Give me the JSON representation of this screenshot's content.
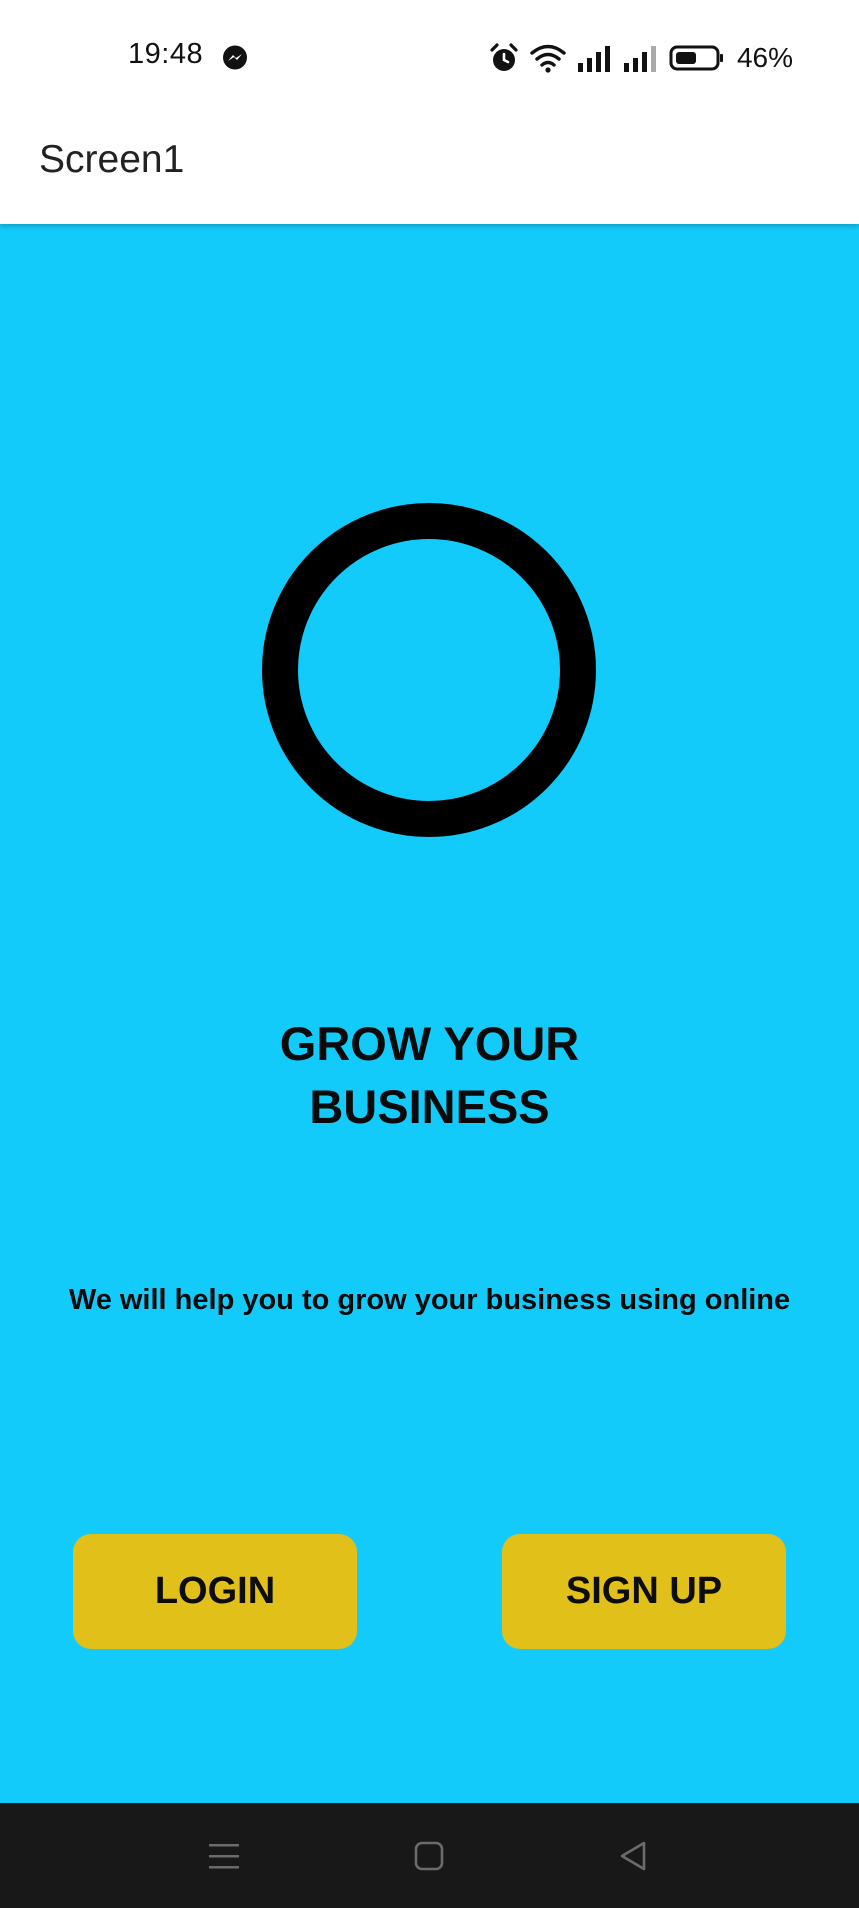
{
  "status_bar": {
    "time": "19:48",
    "battery_percent": "46%",
    "icons": [
      "messenger-icon",
      "alarm-icon",
      "wifi-icon",
      "signal-icon",
      "signal-icon",
      "battery-icon"
    ]
  },
  "app_bar": {
    "title": "Screen1"
  },
  "main": {
    "headline_line1": "GROW YOUR",
    "headline_line2": "BUSINESS",
    "tagline": "We will help you to grow your business using online"
  },
  "buttons": {
    "login_label": "LOGIN",
    "signup_label": "SIGN UP"
  },
  "nav_bar": {
    "icons": [
      "recents-menu-icon",
      "home-square-icon",
      "back-triangle-icon"
    ]
  },
  "colors": {
    "background": "#12cbfa",
    "button": "#e2c01a",
    "ring": "#000000",
    "nav_bar": "#181818"
  }
}
